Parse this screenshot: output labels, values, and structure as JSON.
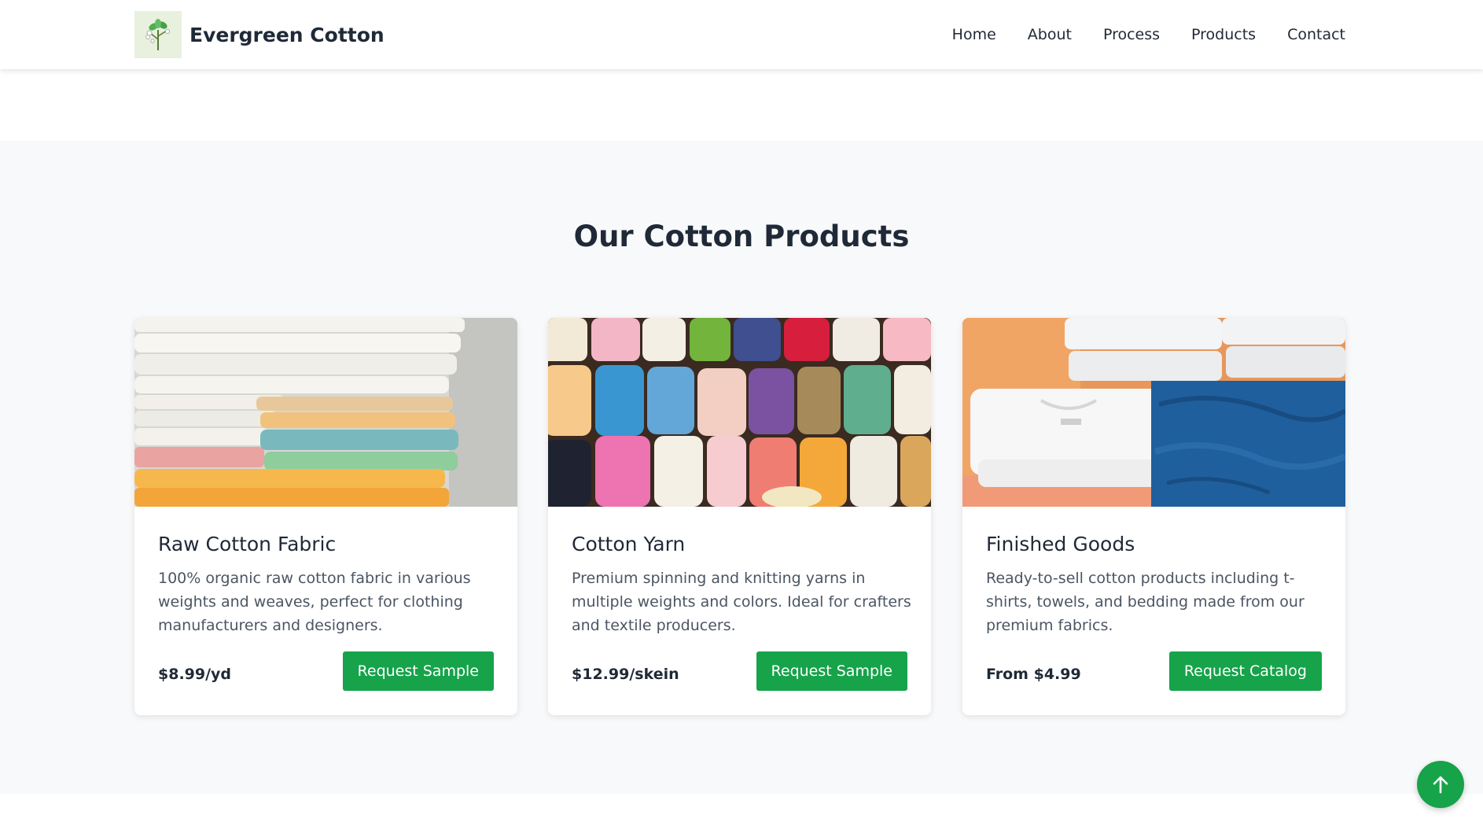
{
  "header": {
    "brand_name": "Evergreen Cotton",
    "logo_icon": "cotton-plant-icon",
    "nav": [
      {
        "label": "Home"
      },
      {
        "label": "About"
      },
      {
        "label": "Process"
      },
      {
        "label": "Products"
      },
      {
        "label": "Contact"
      }
    ]
  },
  "products": {
    "title": "Our Cotton Products",
    "cards": [
      {
        "title": "Raw Cotton Fabric",
        "description": "100% organic raw cotton fabric in various weights and weaves, perfect for clothing manufacturers and designers.",
        "price": "$8.99/yd",
        "button": "Request Sample"
      },
      {
        "title": "Cotton Yarn",
        "description": "Premium spinning and knitting yarns in multiple weights and colors. Ideal for crafters and textile producers.",
        "price": "$12.99/skein",
        "button": "Request Sample"
      },
      {
        "title": "Finished Goods",
        "description": "Ready-to-sell cotton products including t-shirts, towels, and bedding made from our premium fabrics.",
        "price": "From $4.99",
        "button": "Request Catalog"
      }
    ]
  },
  "scroll_top_icon": "arrow-up-icon",
  "colors": {
    "accent": "#16a34a",
    "section_background": "#f8f9fa",
    "text": "#1f2937",
    "muted_text": "#4b5563"
  }
}
